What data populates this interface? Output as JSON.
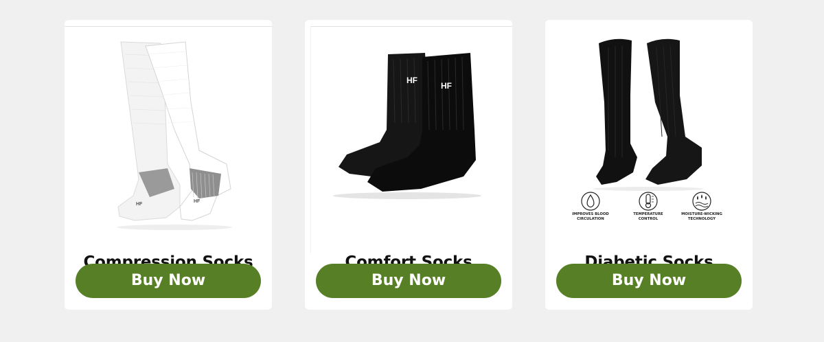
{
  "products": [
    {
      "title": "Compression Socks",
      "button_label": "Buy Now",
      "image": "white-compression-socks"
    },
    {
      "title": "Comfort Socks",
      "button_label": "Buy Now",
      "image": "black-comfort-crew-socks",
      "logo": "HF"
    },
    {
      "title": "Diabetic Socks",
      "button_label": "Buy Now",
      "image": "black-diabetic-knee-socks"
    }
  ],
  "badges": [
    {
      "icon": "blood-drop-icon",
      "label_line1": "IMPROVES BLOOD",
      "label_line2": "CIRCULATION"
    },
    {
      "icon": "thermometer-icon",
      "label_line1": "TEMPERATURE",
      "label_line2": "CONTROL"
    },
    {
      "icon": "moisture-icon",
      "label_line1": "MOISTURE-WICKING",
      "label_line2": "TECHNOLOGY"
    }
  ],
  "colors": {
    "button": "#578026",
    "background": "#f0f0f0",
    "card": "#ffffff"
  }
}
